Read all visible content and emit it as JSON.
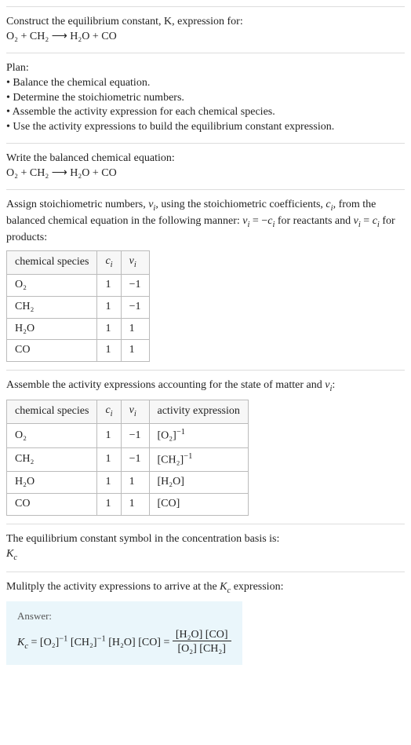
{
  "s1": {
    "title": "Construct the equilibrium constant, K, expression for:",
    "equation": "O₂ + CH₂ ⟶ H₂O + CO"
  },
  "s2": {
    "title": "Plan:",
    "b1": "• Balance the chemical equation.",
    "b2": "• Determine the stoichiometric numbers.",
    "b3": "• Assemble the activity expression for each chemical species.",
    "b4": "• Use the activity expressions to build the equilibrium constant expression."
  },
  "s3": {
    "title": "Write the balanced chemical equation:",
    "equation": "O₂ + CH₂ ⟶ H₂O + CO"
  },
  "s4": {
    "t1": "Assign stoichiometric numbers, ",
    "t1v": "ν",
    "t1i": "i",
    "t2": ", using the stoichiometric coefficients, ",
    "t2v": "c",
    "t2i": "i",
    "t3": ", from the balanced chemical equation in the following manner: ",
    "t3eq1l": "ν",
    "t3eq1li": "i",
    "t3eq1m": " = −",
    "t3eq1r": "c",
    "t3eq1ri": "i",
    "t4": " for reactants and ",
    "t4eq2l": "ν",
    "t4eq2li": "i",
    "t4eq2m": " = ",
    "t4eq2r": "c",
    "t4eq2ri": "i",
    "t5": " for products:",
    "h1": "chemical species",
    "h2c": "c",
    "h2i": "i",
    "h3c": "ν",
    "h3i": "i",
    "r1a": "O₂",
    "r1b": "1",
    "r1c": "−1",
    "r2a": "CH₂",
    "r2b": "1",
    "r2c": "−1",
    "r3a": "H₂O",
    "r3b": "1",
    "r3c": "1",
    "r4a": "CO",
    "r4b": "1",
    "r4c": "1"
  },
  "s5": {
    "t1": "Assemble the activity expressions accounting for the state of matter and ",
    "tv": "ν",
    "ti": "i",
    "t2": ":",
    "h1": "chemical species",
    "h2c": "c",
    "h2i": "i",
    "h3c": "ν",
    "h3i": "i",
    "h4": "activity expression",
    "r1a": "O₂",
    "r1b": "1",
    "r1c": "−1",
    "r1d_base": "[O₂]",
    "r1d_exp": "−1",
    "r2a": "CH₂",
    "r2b": "1",
    "r2c": "−1",
    "r2d_base": "[CH₂]",
    "r2d_exp": "−1",
    "r3a": "H₂O",
    "r3b": "1",
    "r3c": "1",
    "r3d": "[H₂O]",
    "r4a": "CO",
    "r4b": "1",
    "r4c": "1",
    "r4d": "[CO]"
  },
  "s6": {
    "t1": "The equilibrium constant symbol in the concentration basis is:",
    "Kc_K": "K",
    "Kc_c": "c"
  },
  "s7": {
    "t1": "Mulitply the activity expressions to arrive at the ",
    "Kc_K": "K",
    "Kc_c": "c",
    "t2": " expression:",
    "answer_label": "Answer:",
    "lhs_K": "K",
    "lhs_c": "c",
    "eq": " = ",
    "p1b": "[O₂]",
    "p1e": "−1",
    "sp": " ",
    "p2b": "[CH₂]",
    "p2e": "−1",
    "p3": "[H₂O]",
    "p4": "[CO]",
    "eq2": " = ",
    "num": "[H₂O] [CO]",
    "den": "[O₂] [CH₂]"
  }
}
